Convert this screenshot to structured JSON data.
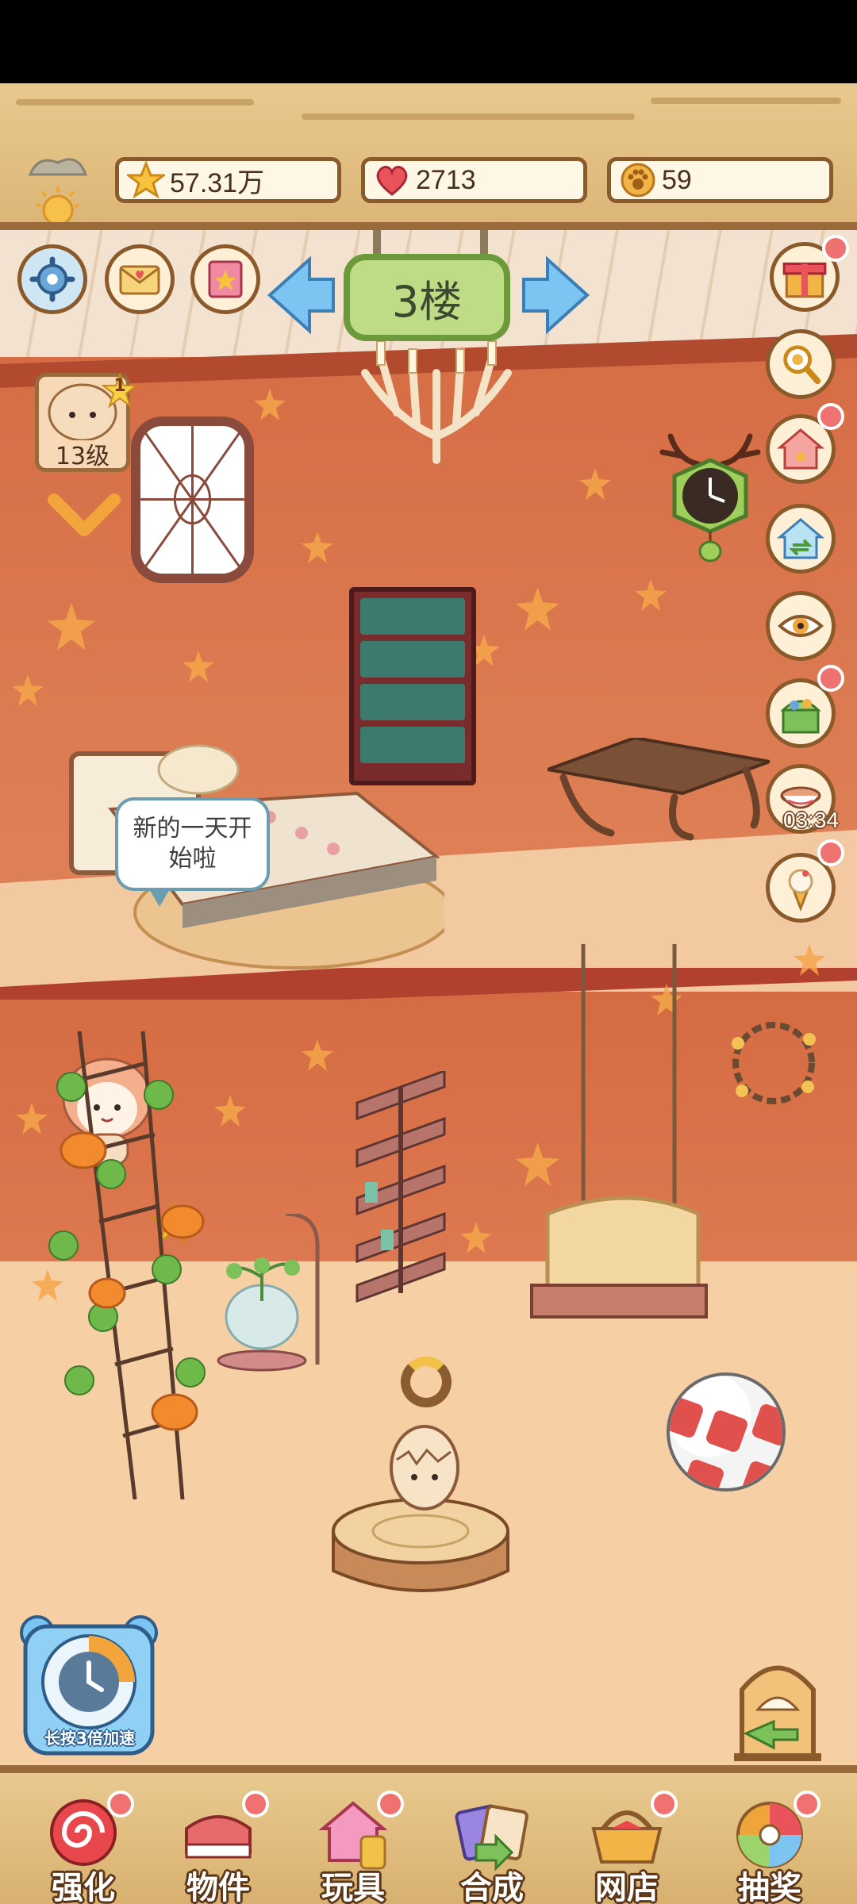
{
  "resources": {
    "stars": "57.31万",
    "hearts": "2713",
    "paws": "59"
  },
  "floor": {
    "label": "3楼"
  },
  "player": {
    "level": "13级",
    "badge": "1"
  },
  "speech": {
    "text": "新的一天开始啦"
  },
  "side_timer": "03:34",
  "speed_up": {
    "label": "长按3倍加速"
  },
  "nav": [
    {
      "label": "强化",
      "icon": "lollipop-icon",
      "color": "#e8484c"
    },
    {
      "label": "物件",
      "icon": "piano-icon",
      "color": "#e86b6b"
    },
    {
      "label": "玩具",
      "icon": "toy-house-icon",
      "color": "#e86aa0"
    },
    {
      "label": "合成",
      "icon": "cards-icon",
      "color": "#8a6ad8"
    },
    {
      "label": "网店",
      "icon": "shop-basket-icon",
      "color": "#e8884a"
    },
    {
      "label": "抽奖",
      "icon": "lottery-wheel-icon",
      "color": "#f0a53a"
    }
  ],
  "colors": {
    "wood": "#e9c98f",
    "wall": "#d9764d",
    "badge": "#f07270",
    "sign": "#bedb86"
  }
}
